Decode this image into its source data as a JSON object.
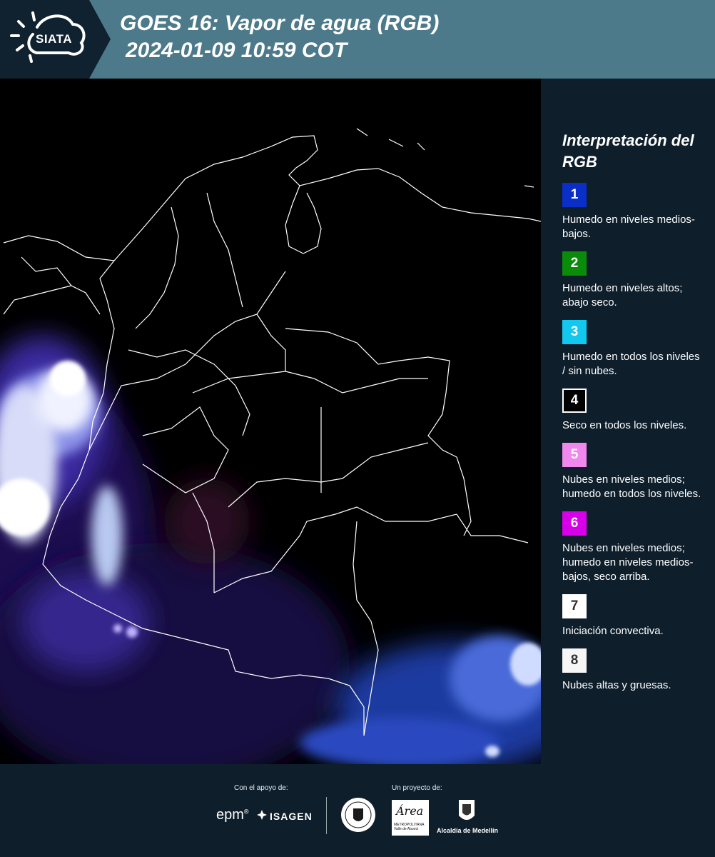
{
  "header": {
    "logo_text": "SIATA",
    "title_line1": "GOES 16: Vapor de agua (RGB)",
    "title_line2": "2024-01-09 10:59 COT"
  },
  "legend": {
    "title": "Interpretación del RGB",
    "items": [
      {
        "number": "1",
        "color": "#0a2fc8",
        "text_color": "#ffffff",
        "text": "Humedo en niveles medios-bajos."
      },
      {
        "number": "2",
        "color": "#0a8c0a",
        "text_color": "#ffffff",
        "text": "Humedo en niveles altos; abajo seco."
      },
      {
        "number": "3",
        "color": "#12c8ee",
        "text_color": "#ffffff",
        "text": "Humedo en todos los niveles / sin nubes."
      },
      {
        "number": "4",
        "color": "#000000",
        "text_color": "#ffffff",
        "text": "Seco en todos los niveles."
      },
      {
        "number": "5",
        "color": "#f088ee",
        "text_color": "#ffffff",
        "text": "Nubes en niveles medios; humedo en todos los niveles."
      },
      {
        "number": "6",
        "color": "#d800e8",
        "text_color": "#ffffff",
        "text": "Nubes en niveles medios; humedo en niveles medios-bajos, seco arriba."
      },
      {
        "number": "7",
        "color": "#ffffff",
        "text_color": "#333333",
        "text": "Iniciación convectiva."
      },
      {
        "number": "8",
        "color": "#f6f6f6",
        "text_color": "#333333",
        "text": "Nubes altas y gruesas."
      }
    ]
  },
  "footer": {
    "support_label": "Con el apoyo de:",
    "project_label": "Un proyecto de:",
    "epm": "epm",
    "epm_mark": "®",
    "isagen": "ISAGEN",
    "area_word": "Área",
    "area_small": "METROPOLITANA Valle de Aburrá",
    "alcaldia": "Alcaldía de Medellín"
  }
}
